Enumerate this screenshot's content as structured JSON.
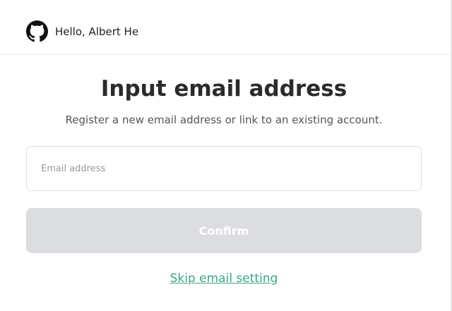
{
  "header": {
    "icon": "github-icon",
    "greeting": "Hello, Albert He"
  },
  "main": {
    "title": "Input email address",
    "subtitle": "Register a new email address or link to an existing account.",
    "email_input": {
      "value": "",
      "placeholder": "Email address"
    },
    "confirm_label": "Confirm",
    "skip_label": "Skip email setting"
  },
  "colors": {
    "link": "#3aa58a",
    "button_disabled_bg": "#dcdde0",
    "button_text": "#ffffff",
    "title_text": "#2b2b2b"
  }
}
